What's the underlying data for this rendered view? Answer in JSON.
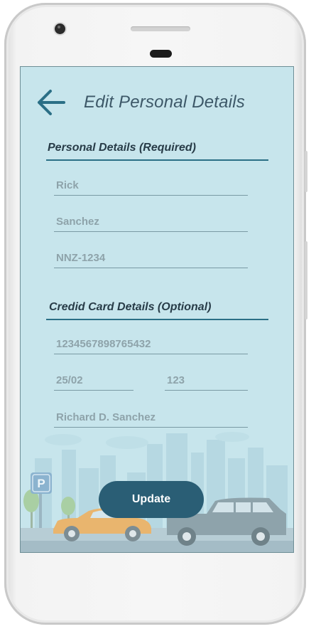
{
  "header": {
    "title": "Edit Personal Details",
    "back_icon": "arrow-left-icon"
  },
  "personal_section": {
    "title": "Personal Details (Required)",
    "fields": {
      "first_name": "Rick",
      "last_name": "Sanchez",
      "license_plate": "NNZ-1234"
    }
  },
  "card_section": {
    "title": "Credid Card Details (Optional)",
    "fields": {
      "card_number": "1234567898765432",
      "expiry": "25/02",
      "cvv": "123",
      "card_holder": "Richard D. Sanchez"
    }
  },
  "actions": {
    "update_label": "Update"
  },
  "background": {
    "parking_sign_label": "P",
    "theme": "city-parking-scene"
  },
  "colors": {
    "screen_bg": "#c7e5ec",
    "accent": "#2a5e75",
    "title_text": "#3d5868",
    "field_text": "#8ea3aa"
  }
}
